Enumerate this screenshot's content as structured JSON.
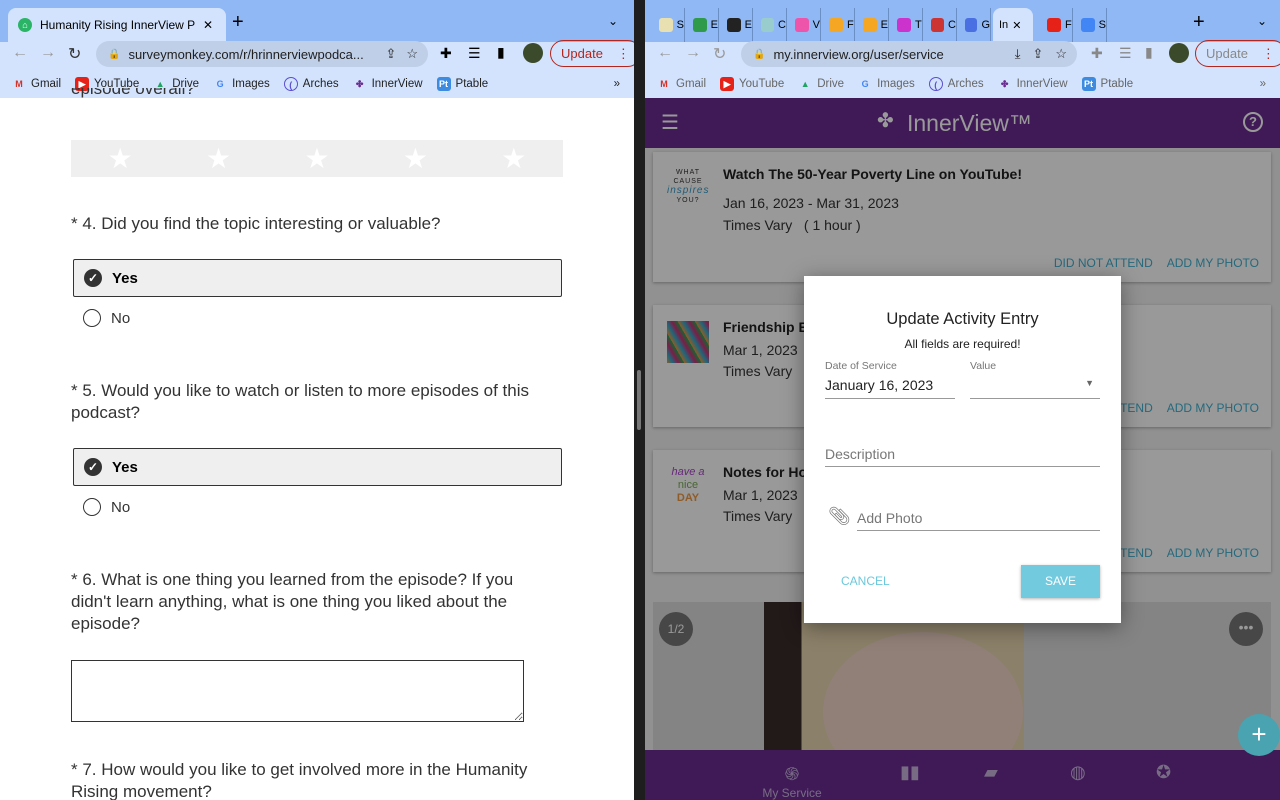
{
  "left": {
    "tab_title": "Humanity Rising InnerView Pod",
    "url": "surveymonkey.com/r/hrinnerviewpodca...",
    "update_label": "Update",
    "bookmarks": [
      "Gmail",
      "YouTube",
      "Drive",
      "Images",
      "Arches",
      "InnerView",
      "Ptable"
    ],
    "survey": {
      "q3_tail": "episode overall?",
      "q4": "* 4. Did you find the topic interesting or valuable?",
      "q4_yes": "Yes",
      "q4_no": "No",
      "q5": "* 5. Would you like to watch or listen to more episodes of this podcast?",
      "q5_yes": "Yes",
      "q5_no": "No",
      "q6": "* 6. What is one thing you learned from the episode? If you didn't learn anything, what is one thing you liked about the episode?",
      "q7": "* 7. How would you like to get involved more in the Humanity Rising movement?"
    }
  },
  "right": {
    "tabs": [
      "S",
      "E",
      "E",
      "C",
      "V",
      "F",
      "E",
      "T",
      "C",
      "G",
      "In",
      "F",
      "S"
    ],
    "active_tab": "In",
    "url": "my.innerview.org/user/service",
    "update_label": "Update",
    "bookmarks": [
      "Gmail",
      "YouTube",
      "Drive",
      "Images",
      "Arches",
      "InnerView",
      "Ptable"
    ],
    "brand": "InnerView™",
    "cards": [
      {
        "title": "Watch The 50-Year Poverty Line on YouTube!",
        "dates": "Jan 16, 2023 - Mar 31, 2023",
        "time": "Times Vary   ( 1 hour )",
        "actions": [
          "DID NOT ATTEND",
          "ADD MY PHOTO"
        ]
      },
      {
        "title": "Friendship B",
        "dates": "Mar 1, 2023",
        "time": "Times Vary",
        "actions": [
          "TEND",
          "ADD MY PHOTO"
        ]
      },
      {
        "title": "Notes for Ho",
        "dates": "Mar 1, 2023",
        "time": "Times Vary",
        "actions": [
          "TEND",
          "ADD MY PHOTO"
        ]
      }
    ],
    "photo_counter": "1/2",
    "bottom_nav": {
      "my_service": "My Service"
    },
    "dialog": {
      "title": "Update Activity Entry",
      "subtitle": "All fields are required!",
      "date_label": "Date of Service",
      "date_value": "January 16, 2023",
      "value_label": "Value",
      "description_placeholder": "Description",
      "photo_placeholder": "Add Photo",
      "cancel": "CANCEL",
      "save": "SAVE"
    }
  }
}
